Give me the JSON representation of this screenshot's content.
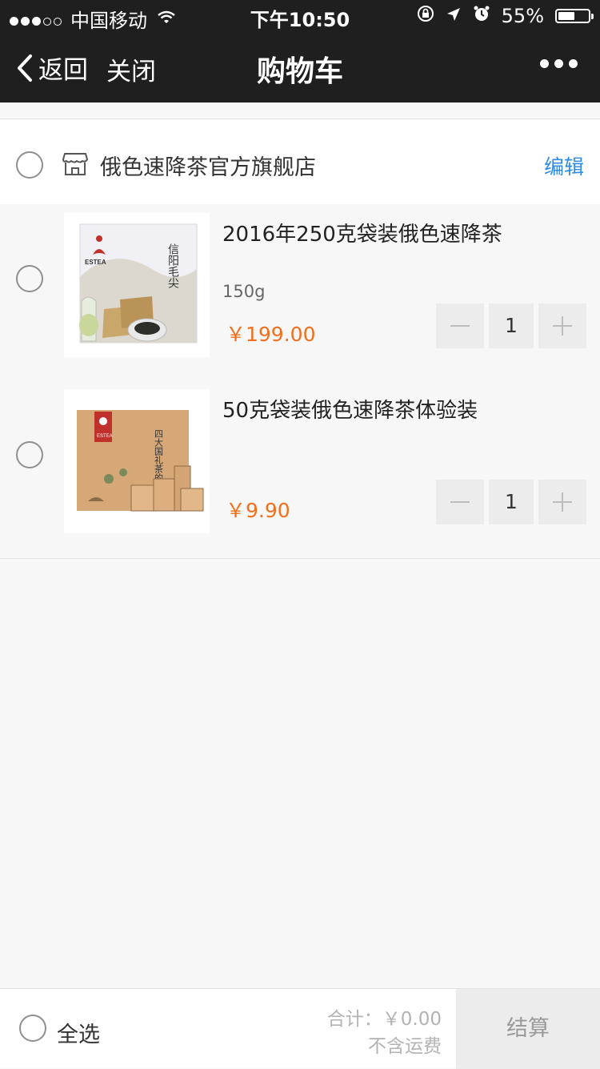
{
  "status_bar": {
    "carrier": "中国移动",
    "time": "下午10:50",
    "battery_percent": "55%",
    "battery_level": 0.55
  },
  "nav": {
    "back_label": "返回",
    "close_label": "关闭",
    "title": "购物车"
  },
  "store": {
    "name": "俄色速降茶官方旗舰店",
    "edit_label": "编辑"
  },
  "items": [
    {
      "title": "2016年250克袋装俄色速降茶",
      "spec": "150g",
      "price": "￥199.00",
      "quantity": "1",
      "image_text": "信阳毛尖",
      "brand": "ESTEA"
    },
    {
      "title": "50克袋装俄色速降茶体验装",
      "spec": "",
      "price": "￥9.90",
      "quantity": "1",
      "image_text": "四大国礼茶的故事",
      "brand": "ESTEA"
    }
  ],
  "footer": {
    "select_all_label": "全选",
    "total_text": "合计：￥0.00",
    "shipping_note": "不含运费",
    "checkout_label": "结算"
  },
  "colors": {
    "bar_background": "#1f1f1f",
    "price": "#f2701c",
    "link": "#2e8be6"
  }
}
